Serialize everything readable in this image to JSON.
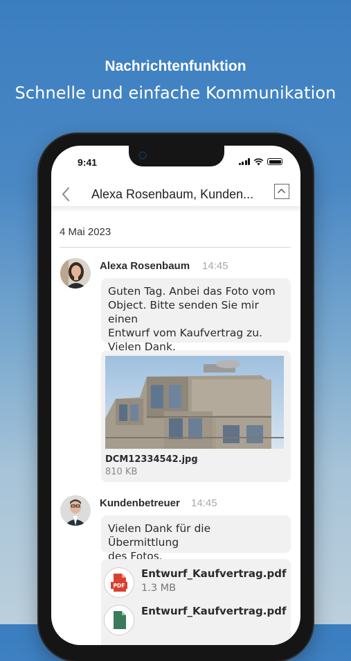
{
  "promo": {
    "headline": "Nachrichtenfunktion",
    "subline": "Schnelle und einfache Kommunikation"
  },
  "status_bar": {
    "time": "9:41"
  },
  "conversation": {
    "title": "Alexa Rosenbaum, Kunden...",
    "date": "4 Mai 2023"
  },
  "messages": [
    {
      "sender": "Alexa Rosenbaum",
      "time": "14:45",
      "text": "Guten Tag. Anbei das Foto vom\nObject. Bitte senden Sie mir einen\nEntwurf vom Kaufvertrag zu.\nVielen Dank.",
      "attachment": {
        "file_name": "DCM12334542.jpg",
        "file_size": "810 KB"
      }
    },
    {
      "sender": "Kundenbetreuer",
      "time": "14:45",
      "text": "Vielen Dank für die Übermittlung\ndes Fotos.",
      "documents": [
        {
          "name": "Entwurf_Kaufvertrag.pdf",
          "size": "1.3 MB",
          "badge": "PDF",
          "color": "#d9412f"
        },
        {
          "name": "Entwurf_Kaufvertrag.pdf",
          "size": "",
          "badge": "",
          "color": "#3b7a5a"
        }
      ]
    }
  ],
  "colors": {
    "background_top": "#3b7ec0",
    "bubble": "#f1f1f1",
    "pdf_red": "#d9412f"
  }
}
